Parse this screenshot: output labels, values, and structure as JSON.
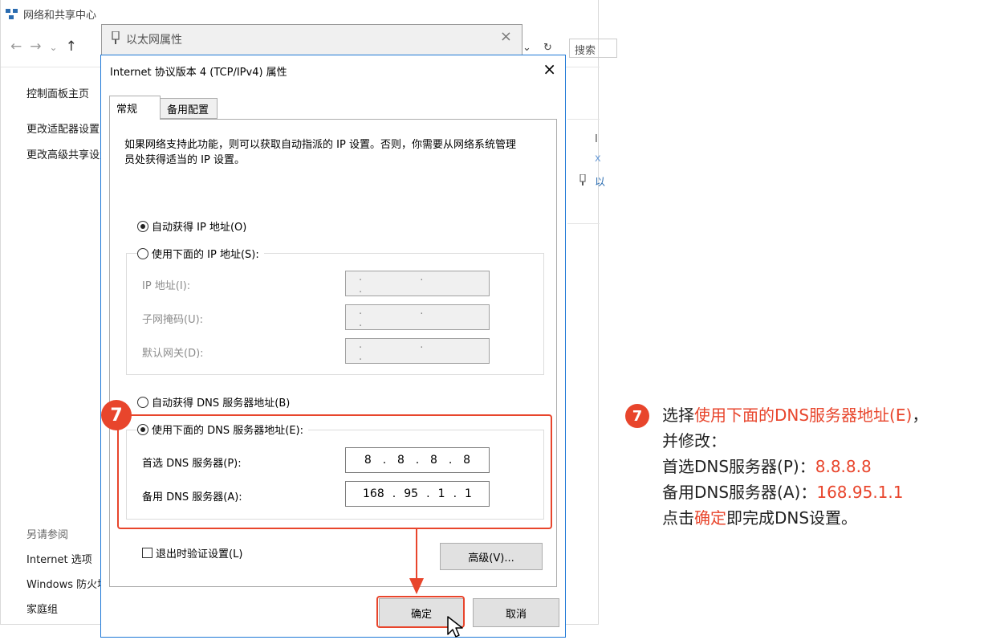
{
  "background_window": {
    "title": "网络和共享中心",
    "nav_arrows": [
      "←",
      "→",
      "⌄",
      "↑"
    ],
    "address_dropdown": "⌄",
    "refresh": "↻",
    "search_placeholder": "搜索",
    "sidebar_links": [
      "控制面板主页",
      "更改适配器设置",
      "更改高级共享设置"
    ],
    "see_also_header": "另请参阅",
    "see_also_links": [
      "Internet 选项",
      "Windows 防火墙",
      "家庭组"
    ],
    "right_column_fragments": [
      "I",
      "x",
      "以"
    ]
  },
  "ethernet_window": {
    "title": "以太网属性",
    "close": "×"
  },
  "dialog": {
    "title": "Internet 协议版本 4 (TCP/IPv4) 属性",
    "close": "×",
    "tabs": [
      {
        "label": "常规",
        "active": true
      },
      {
        "label": "备用配置",
        "active": false
      }
    ],
    "description": "如果网络支持此功能，则可以获取自动指派的 IP 设置。否则，你需要从网络系统管理员处获得适当的 IP 设置。",
    "ip_auto_label": "自动获得 IP 地址(O)",
    "ip_manual_label": "使用下面的 IP 地址(S):",
    "ip_auto_selected": true,
    "ip_fields": [
      {
        "label": "IP 地址(I):",
        "value": ". . ."
      },
      {
        "label": "子网掩码(U):",
        "value": ". . ."
      },
      {
        "label": "默认网关(D):",
        "value": ". . ."
      }
    ],
    "dns_auto_label": "自动获得 DNS 服务器地址(B)",
    "dns_manual_label": "使用下面的 DNS 服务器地址(E):",
    "dns_manual_selected": true,
    "dns_fields": [
      {
        "label": "首选 DNS 服务器(P):",
        "octets": [
          "8",
          "8",
          "8",
          "8"
        ]
      },
      {
        "label": "备用 DNS 服务器(A):",
        "octets": [
          "168",
          "95",
          "1",
          "1"
        ]
      }
    ],
    "validate_label": "退出时验证设置(L)",
    "validate_checked": false,
    "advanced_button": "高级(V)...",
    "ok_button": "确定",
    "cancel_button": "取消"
  },
  "annotation": {
    "step": "7",
    "accent_color": "#e8452c",
    "line1_prefix": "选择",
    "line1_highlight": "使用下面的DNS服务器地址(E)",
    "line1_suffix": "，",
    "line2": "并修改：",
    "line3_label": "首选DNS服务器(P)：",
    "line3_value": "8.8.8.8",
    "line4_label": "备用DNS服务器(A)：",
    "line4_value": "168.95.1.1",
    "line5_prefix": "点击",
    "line5_highlight": "确定",
    "line5_suffix": "即完成DNS设置。"
  }
}
